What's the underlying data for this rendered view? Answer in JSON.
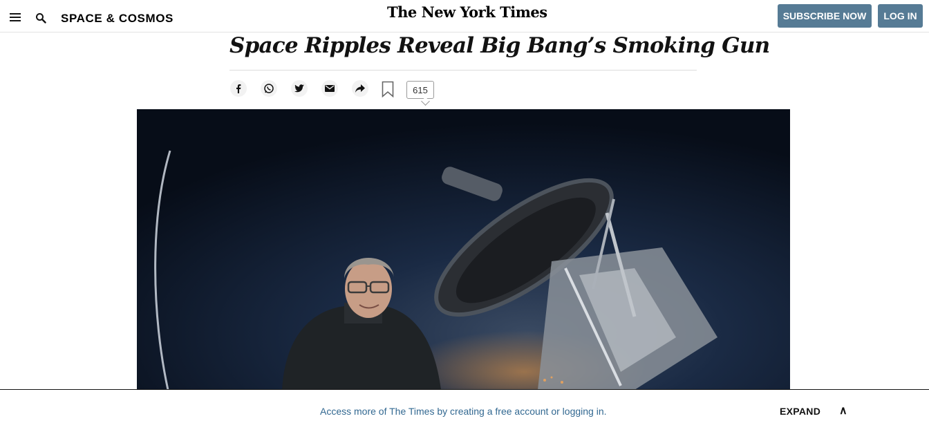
{
  "header": {
    "section": "SPACE & COSMOS",
    "logo": "The New York Times",
    "subscribe_label": "SUBSCRIBE NOW",
    "login_label": "LOG IN"
  },
  "article": {
    "headline": "Space Ripples Reveal Big Bang’s Smoking Gun",
    "comment_count": "615"
  },
  "banner": {
    "message": "Access more of The Times by creating a free account or logging in.",
    "expand_label": "EXPAND",
    "caret": "∧"
  },
  "colors": {
    "button_bg": "#567b95",
    "banner_link": "#326891",
    "photo_sky": "#0d1626"
  },
  "icons": [
    "menu-icon",
    "search-icon",
    "facebook-icon",
    "whatsapp-icon",
    "twitter-icon",
    "email-icon",
    "share-icon",
    "bookmark-icon",
    "comment-icon"
  ]
}
